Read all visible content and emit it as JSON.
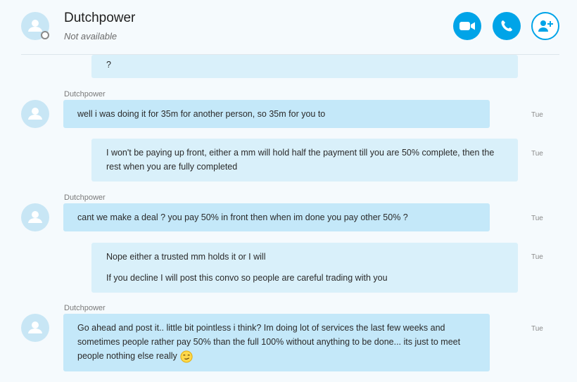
{
  "header": {
    "contact_name": "Dutchpower",
    "status": "Not available",
    "avatar_icon": "user-icon",
    "buttons": {
      "video_call_icon": "video-camera-icon",
      "voice_call_icon": "phone-icon",
      "add_people_icon": "add-person-icon"
    }
  },
  "colors": {
    "accent": "#00a4e8",
    "incoming_bubble": "#c4e8f9",
    "outgoing_bubble": "#d9f0fa",
    "avatar_bg": "#c8e6f5"
  },
  "messages": [
    {
      "direction": "out",
      "lines": [
        "?"
      ]
    },
    {
      "direction": "in",
      "sender": "Dutchpower",
      "lines": [
        "well i was doing it for 35m for another person, so 35m for you to"
      ],
      "time": "Tue"
    },
    {
      "direction": "out",
      "lines": [
        "I won't be paying up front, either a mm will hold half the payment till you are 50% complete, then the rest when you are fully completed"
      ],
      "time": "Tue"
    },
    {
      "direction": "in",
      "sender": "Dutchpower",
      "lines": [
        "cant we make a deal ? you pay 50% in front then when im done you pay other 50% ?"
      ],
      "time": "Tue"
    },
    {
      "direction": "out",
      "lines": [
        "Nope either a trusted mm holds it or I will",
        "If you decline I will post this convo so people are careful trading with you"
      ],
      "time": "Tue"
    },
    {
      "direction": "in",
      "sender": "Dutchpower",
      "lines": [
        "Go ahead and post it.. little bit pointless i think? Im doing lot of services the last few weeks and sometimes people rather pay 50% than the full 100% without anything to be done... its just to meet people nothing else really"
      ],
      "emoji": "smirk-emoji",
      "time": "Tue"
    }
  ]
}
